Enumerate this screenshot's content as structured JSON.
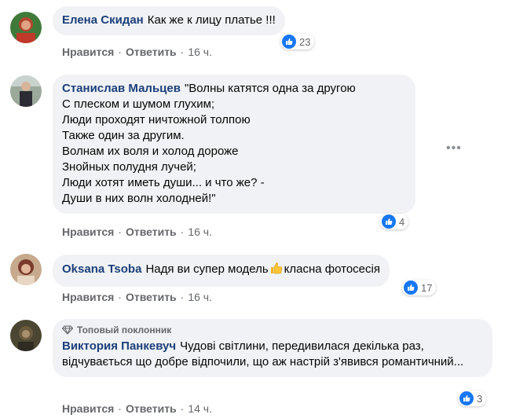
{
  "comments": [
    {
      "author": "Елена Скидан",
      "text": "Как же к лицу платье !!!",
      "reactions": "23",
      "like": "Нравится",
      "reply": "Ответить",
      "time": "16 ч.",
      "avatar_icon": "avatar-photo"
    },
    {
      "author": "Станислав Мальцев",
      "text": "\"Волны катятся одна за другою\nС плеском и шумом глухим;\nЛюди проходят ничтожной толпою\nТакже один за другим.\nВолнам их воля и холод дороже\nЗнойных полудня лучей;\nЛюди хотят иметь души... и что же? -\nДуши в них волн холодней!\"",
      "reactions": "4",
      "like": "Нравится",
      "reply": "Ответить",
      "time": "16 ч.",
      "more_icon": "more-horizontal-icon"
    },
    {
      "author": "Oksana Tsoba",
      "text_before": "Надя ви супер модель",
      "text_after": "класна фотосесія",
      "emoji_icon": "thumbs-up-emoji",
      "reactions": "17",
      "like": "Нравится",
      "reply": "Ответить",
      "time": "16 ч."
    },
    {
      "badge": "Топовый поклонник",
      "badge_icon": "diamond-icon",
      "author": "Виктория Панкевуч",
      "text": "Чудові світлини, передивилася декілька раз, відчувається що добре відпочили, що аж настрій з'явився романтичний...",
      "reactions": "3",
      "like": "Нравится",
      "reply": "Ответить",
      "time": "14 ч."
    }
  ],
  "colors": {
    "author": "#1c3f7a",
    "bubble": "#f0f2f5",
    "like_blue": "#1877f2",
    "meta": "#65676b"
  }
}
